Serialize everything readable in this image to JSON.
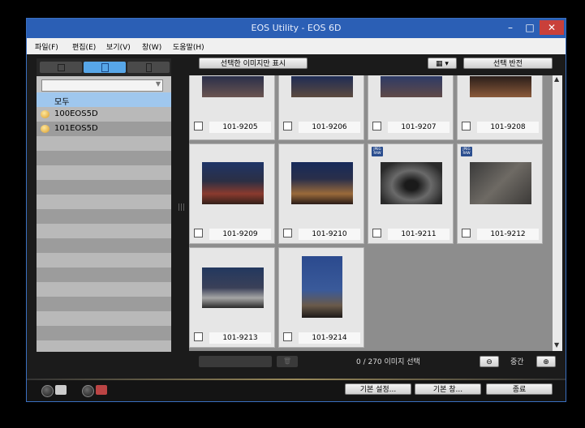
{
  "window": {
    "title": "EOS Utility - EOS 6D",
    "minimize": "–",
    "maximize": "□",
    "close": "✕",
    "accent": "#2b5fb5",
    "close_color": "#c9403a"
  },
  "menu": {
    "items": [
      "파일(F)",
      "편집(E)",
      "보기(V)",
      "창(W)",
      "도움말(H)"
    ]
  },
  "left_panel": {
    "dropdown_value": "",
    "tree": [
      {
        "label": "모두",
        "selected": true
      },
      {
        "label": "100EOS5D",
        "icon": "folder-icon"
      },
      {
        "label": "101EOS5D",
        "icon": "folder-icon"
      }
    ]
  },
  "toolbar": {
    "show_selected": "선택한 이미지만 표시",
    "sort_icon": "sort-icon",
    "invert_selection": "선택 반전"
  },
  "thumbnails": [
    {
      "name": "101-9205",
      "badge": false
    },
    {
      "name": "101-9206",
      "badge": false
    },
    {
      "name": "101-9207",
      "badge": false
    },
    {
      "name": "101-9208",
      "badge": false
    },
    {
      "name": "101-9209",
      "badge": false
    },
    {
      "name": "101-9210",
      "badge": false
    },
    {
      "name": "101-9211",
      "badge": true
    },
    {
      "name": "101-9212",
      "badge": true
    },
    {
      "name": "101-9213",
      "badge": false
    },
    {
      "name": "101-9214",
      "badge": false
    }
  ],
  "badge": {
    "line1": "JPEG",
    "line2": "RAW"
  },
  "status": {
    "selection_count": "0 / 270 이미지 선택",
    "zoom_label": "중간",
    "zoom_out_icon": "zoom-out-icon",
    "zoom_in_icon": "zoom-in-icon"
  },
  "footer": {
    "preferences": "기본 설정...",
    "main_window": "기본 창...",
    "quit": "종료"
  }
}
